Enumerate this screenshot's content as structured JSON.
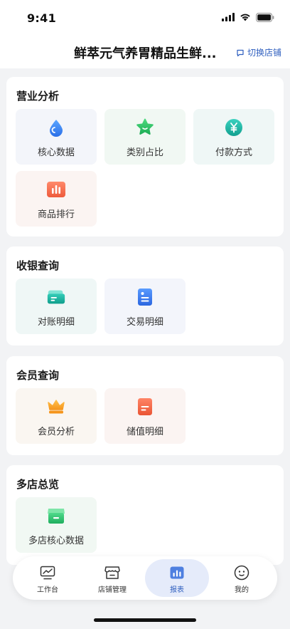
{
  "status_bar": {
    "time": "9:41"
  },
  "header": {
    "store_name": "鲜萃元气养胃精品生鲜...",
    "switch_store_label": "切换店铺"
  },
  "sections": [
    {
      "title": "营业分析",
      "items": [
        {
          "label": "核心数据",
          "icon": "droplet-icon"
        },
        {
          "label": "类别占比",
          "icon": "star-icon"
        },
        {
          "label": "付款方式",
          "icon": "yen-coin-icon"
        },
        {
          "label": "商品排行",
          "icon": "bar-chart-icon"
        }
      ]
    },
    {
      "title": "收银查询",
      "items": [
        {
          "label": "对账明细",
          "icon": "ticket-icon"
        },
        {
          "label": "交易明细",
          "icon": "document-icon"
        }
      ]
    },
    {
      "title": "会员查询",
      "items": [
        {
          "label": "会员分析",
          "icon": "crown-icon"
        },
        {
          "label": "储值明细",
          "icon": "note-icon"
        }
      ]
    },
    {
      "title": "多店总览",
      "items": [
        {
          "label": "多店核心数据",
          "icon": "store-icon"
        }
      ]
    }
  ],
  "tab_bar": {
    "tabs": [
      {
        "label": "工作台",
        "icon": "monitor-chart-icon"
      },
      {
        "label": "店铺管理",
        "icon": "shop-icon"
      },
      {
        "label": "报表",
        "icon": "report-icon"
      },
      {
        "label": "我的",
        "icon": "face-icon"
      }
    ],
    "active_tab": "报表"
  },
  "colors": {
    "accent": "#2f5fbf",
    "background": "#f2f3f5",
    "active_tab_bg": "#e5ebfa"
  }
}
